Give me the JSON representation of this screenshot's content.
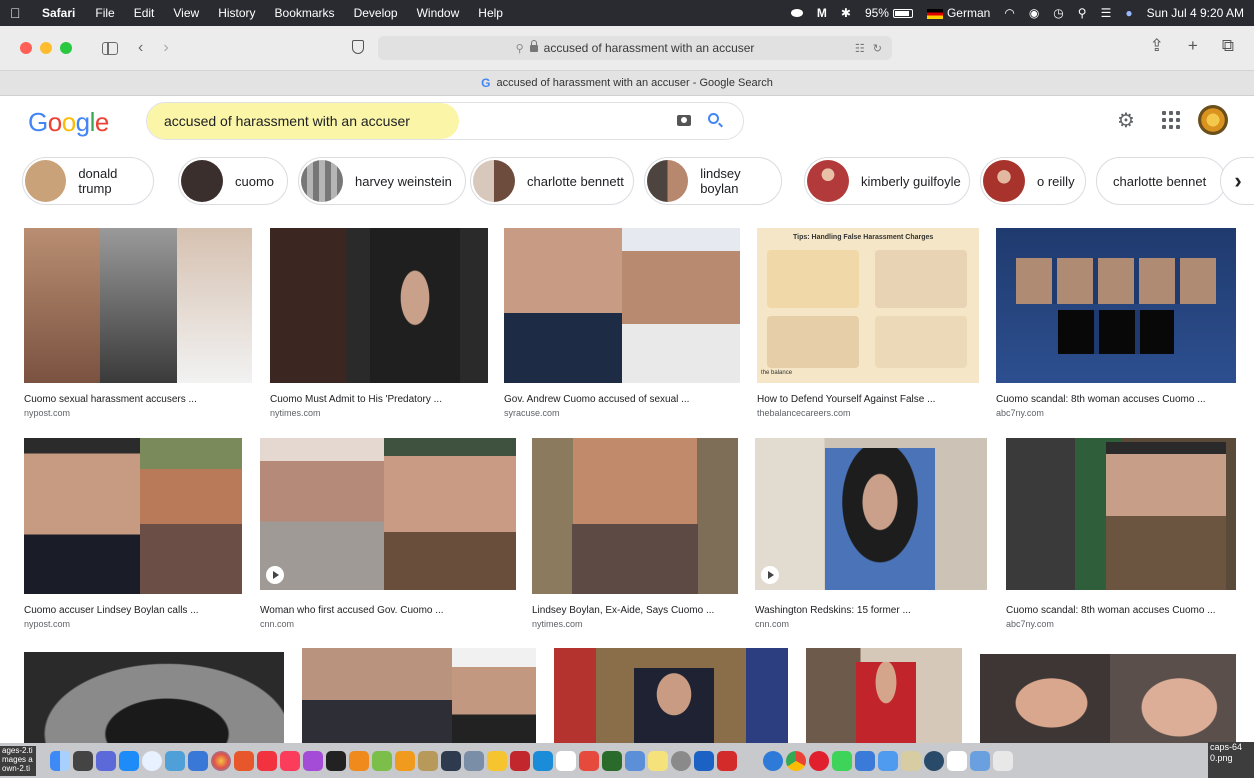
{
  "menubar": {
    "app_name": "Safari",
    "items": [
      "File",
      "Edit",
      "View",
      "History",
      "Bookmarks",
      "Develop",
      "Window",
      "Help"
    ],
    "battery": "95%",
    "language": "German",
    "datetime": "Sun Jul 4  9:20 AM"
  },
  "browser": {
    "address": "accused of harassment with an accuser",
    "tab_title": "accused of harassment with an accuser - Google Search"
  },
  "google": {
    "logo_letters": [
      "G",
      "o",
      "o",
      "g",
      "l",
      "e"
    ],
    "query": "accused of harassment with an accuser"
  },
  "chips": [
    {
      "label": "donald trump",
      "color": "#c9a27a"
    },
    {
      "label": "cuomo",
      "color": "#3a2f2d"
    },
    {
      "label": "harvey weinstein",
      "color": "#8d8d8d"
    },
    {
      "label": "charlotte bennett",
      "color": "#6d4c3d"
    },
    {
      "label": "lindsey boylan",
      "color": "#4d4440"
    },
    {
      "label": "kimberly guilfoyle",
      "color": "#b23a3a"
    },
    {
      "label": "o reilly",
      "color": "#a8322c"
    },
    {
      "label": "charlotte bennet",
      "color": ""
    }
  ],
  "results": [
    {
      "caption": "Cuomo sexual harassment accusers ...",
      "source": "nypost.com"
    },
    {
      "caption": "Cuomo Must Admit to His 'Predatory ...",
      "source": "nytimes.com"
    },
    {
      "caption": "Gov. Andrew Cuomo accused of sexual ...",
      "source": "syracuse.com"
    },
    {
      "caption": "How to Defend Yourself Against False ...",
      "source": "thebalancecareers.com",
      "thumb_title": "Tips: Handling False Harassment Charges",
      "thumb_brand": "the balance"
    },
    {
      "caption": "Cuomo scandal: 8th woman accuses Cuomo ...",
      "source": "abc7ny.com"
    },
    {
      "caption": "Cuomo accuser Lindsey Boylan calls ...",
      "source": "nypost.com"
    },
    {
      "caption": "Woman who first accused Gov. Cuomo ...",
      "source": "cnn.com"
    },
    {
      "caption": "Lindsey Boylan, Ex-Aide, Says Cuomo ...",
      "source": "nytimes.com"
    },
    {
      "caption": "Washington Redskins: 15 former ...",
      "source": "cnn.com"
    },
    {
      "caption": "Cuomo scandal: 8th woman accuses Cuomo ...",
      "source": "abc7ny.com"
    }
  ],
  "dock": {
    "left_label": "ages-2.ti\nmages a\nown-2.ti",
    "right_label": "caps-64\n0.png"
  }
}
